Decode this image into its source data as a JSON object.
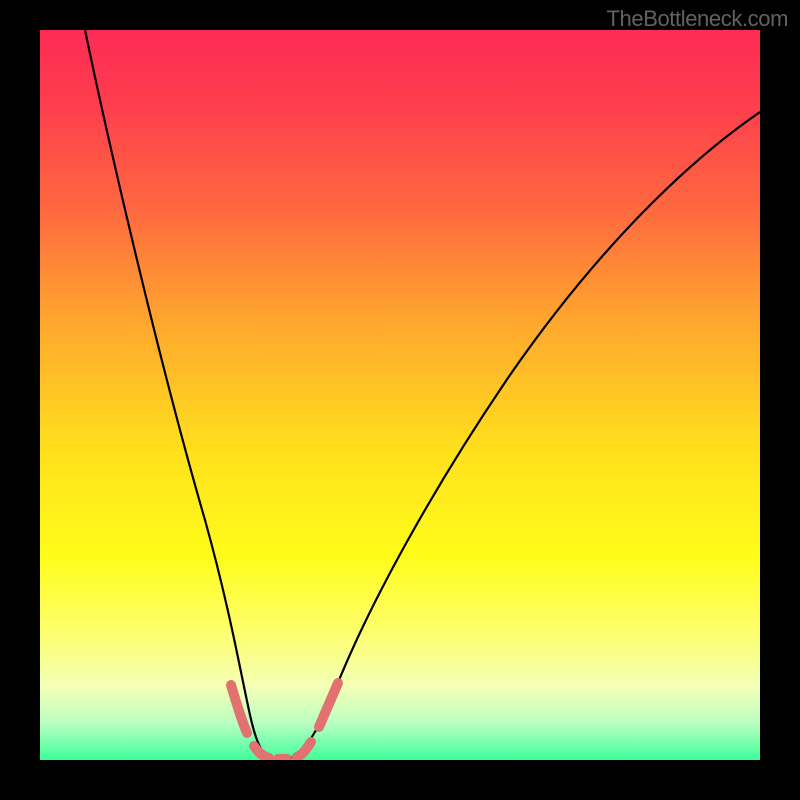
{
  "watermark": "TheBottleneck.com",
  "chart_data": {
    "type": "line",
    "title": "",
    "xlabel": "",
    "ylabel": "",
    "xlim": [
      0,
      100
    ],
    "ylim": [
      0,
      100
    ],
    "x": [
      0,
      5,
      10,
      15,
      20,
      22,
      25,
      28,
      30,
      33,
      35,
      40,
      50,
      60,
      70,
      80,
      90,
      100
    ],
    "series": [
      {
        "name": "black-curve",
        "values": [
          null,
          100,
          80,
          55,
          30,
          20,
          8,
          1,
          0,
          0,
          1,
          8,
          25,
          42,
          57,
          70,
          80,
          88
        ]
      }
    ],
    "dashed_markers": [
      {
        "x_range": [
          24,
          28
        ],
        "y_approx": 3
      },
      {
        "x_range": [
          28,
          30
        ],
        "y_approx": 0
      },
      {
        "x_range": [
          32,
          34
        ],
        "y_approx": 0.4
      },
      {
        "x_range": [
          35,
          38
        ],
        "y_approx": 3
      }
    ],
    "gradient_stops": [
      {
        "pos": 0,
        "color": "#fd2b54"
      },
      {
        "pos": 25,
        "color": "#ff6a3f"
      },
      {
        "pos": 58,
        "color": "#ffe11c"
      },
      {
        "pos": 82,
        "color": "#fdff69"
      },
      {
        "pos": 100,
        "color": "#3dff9b"
      }
    ]
  }
}
